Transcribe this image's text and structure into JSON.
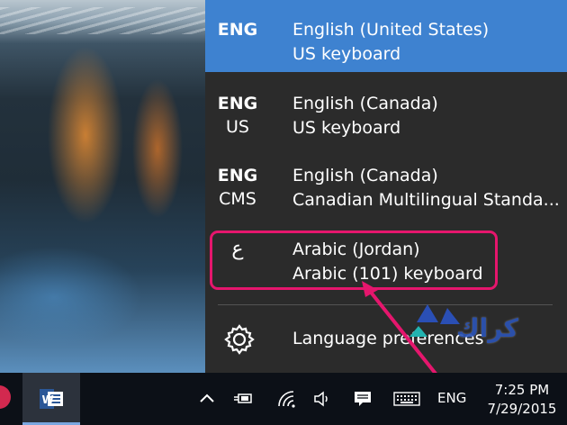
{
  "languages": [
    {
      "code_line1": "ENG",
      "code_line2": "",
      "name": "English (United States)",
      "keyboard": "US keyboard",
      "selected": true
    },
    {
      "code_line1": "ENG",
      "code_line2": "US",
      "name": "English (Canada)",
      "keyboard": "US keyboard",
      "selected": false
    },
    {
      "code_line1": "ENG",
      "code_line2": "CMS",
      "name": "English (Canada)",
      "keyboard": "Canadian Multilingual Standa...",
      "selected": false
    },
    {
      "code_line1": "ع",
      "code_line2": "",
      "name": "Arabic (Jordan)",
      "keyboard": "Arabic (101) keyboard",
      "selected": false
    }
  ],
  "preferences": {
    "label": "Language preferences",
    "icon": "gear-icon"
  },
  "taskbar": {
    "apps": [
      {
        "icon": "word-icon",
        "letter": "W"
      }
    ],
    "tray_icons": [
      "chevron-up-icon",
      "power-plug-icon",
      "wifi-icon",
      "volume-icon",
      "action-center-icon",
      "keyboard-icon"
    ],
    "input_indicator": "ENG",
    "time": "7:25 PM",
    "date": "7/29/2015"
  },
  "watermark": {
    "text": "كراك"
  },
  "colors": {
    "selected": "#3e82d0",
    "flyout_bg": "#2b2b2b",
    "highlight": "#e5166d",
    "taskbar": "#0c1017"
  }
}
